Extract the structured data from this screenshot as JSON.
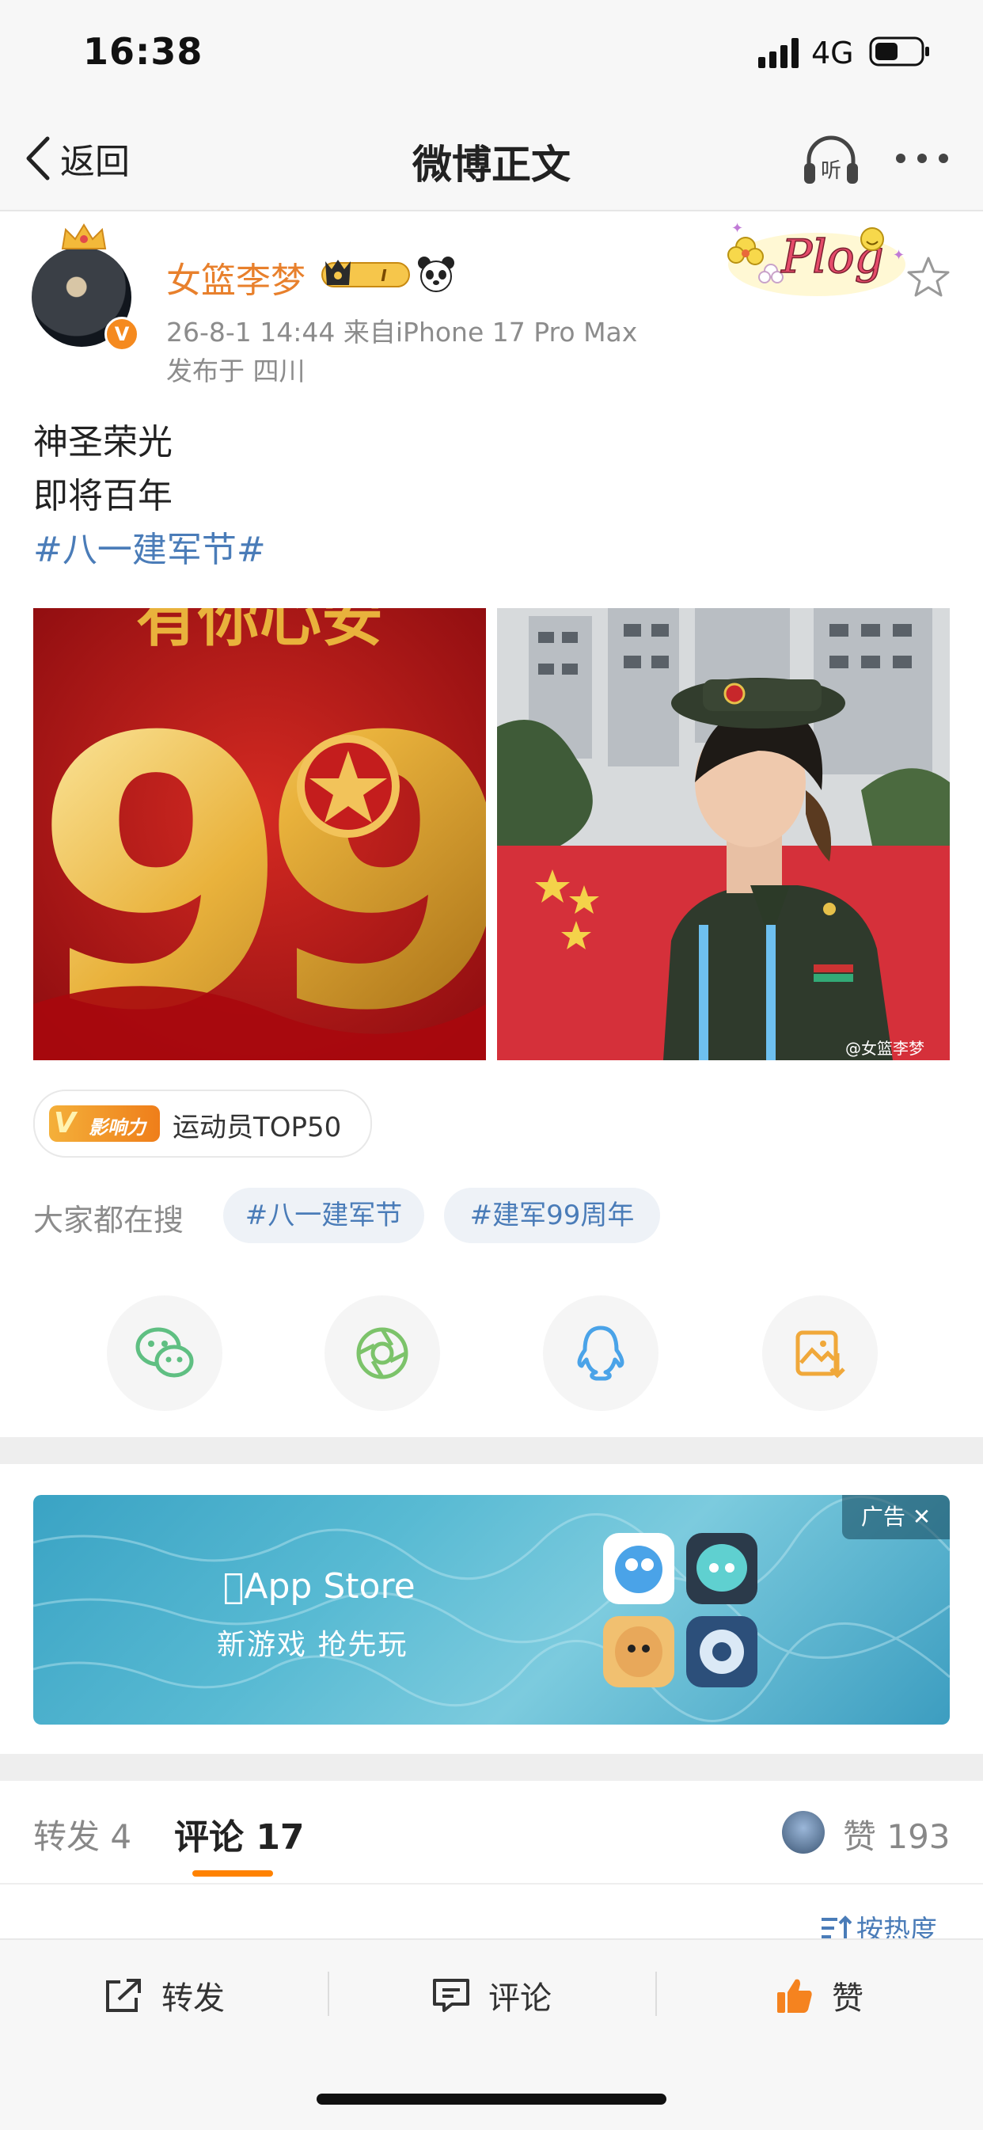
{
  "status_bar": {
    "time": "16:38",
    "network": "4G"
  },
  "nav": {
    "back_label": "返回",
    "title": "微博正文"
  },
  "post": {
    "username": "女篮李梦",
    "meta": "26-8-1 14:44  来自iPhone 17 Pro Max",
    "location": "发布于 四川",
    "badge_level": "I",
    "sticker_text": "Plog",
    "verified_mark": "V",
    "lines": [
      "神圣荣光",
      "即将百年"
    ],
    "hashtag": "#八一建军节#",
    "image1_big_number": "99",
    "image1_top_text": "有你心安",
    "image2_watermark": "@女篮李梦",
    "influence_tag": "影响力",
    "influence_label": "运动员TOP50"
  },
  "search": {
    "label": "大家都在搜",
    "chips": [
      "#八一建军节",
      "#建军99周年"
    ]
  },
  "share": [
    "wechat-icon",
    "moments-icon",
    "qq-icon",
    "save-image-icon"
  ],
  "ad": {
    "store_label": "App Store",
    "slogan": "新游戏 抢先玩",
    "tag": "广告 ✕"
  },
  "tabs": {
    "repost": "转发 4",
    "comment": "评论 17",
    "like": "赞 193"
  },
  "sort_label": "按热度",
  "toolbar": {
    "repost": "转发",
    "comment": "评论",
    "like": "赞"
  },
  "colors": {
    "accent": "#ff8200",
    "link": "#4a7cb8",
    "username": "#e8802c"
  }
}
